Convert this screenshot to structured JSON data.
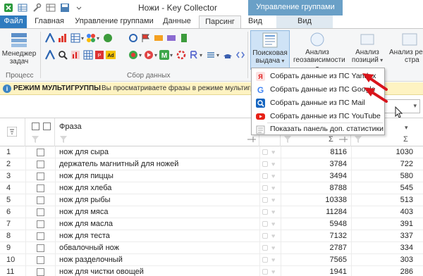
{
  "window": {
    "title": "Ножи - Key Collector",
    "context_group": "Управление группами"
  },
  "tabs": [
    {
      "label": "Файл"
    },
    {
      "label": "Главная"
    },
    {
      "label": "Управление группами"
    },
    {
      "label": "Данные"
    },
    {
      "label": "Парсинг"
    },
    {
      "label": "Вид"
    },
    {
      "label": "Вид"
    }
  ],
  "ribbon": {
    "manager_label": "Менеджер задач",
    "group_process": "Процесс",
    "group_collect": "Сбор данных",
    "search_results": "Поисковая выдача",
    "geo_analysis": "Анализ геозависимости",
    "position_analysis": "Анализ позиций",
    "analysis_cut": "Анализ ре",
    "analysis_cut_2": "стра"
  },
  "infobar": {
    "title": "РЕЖИМ МУЛЬТИГРУППЫ",
    "text": "Вы просматриваете фразы в режиме мультигрупп"
  },
  "menu": {
    "items": [
      {
        "label": "Собрать данные из ПС Yandex",
        "icon": "yandex-icon"
      },
      {
        "label": "Собрать данные из ПС Google",
        "icon": "google-icon"
      },
      {
        "label": "Собрать данные из ПС Mail",
        "icon": "mail-search-icon"
      },
      {
        "label": "Собрать данные из ПС YouTube",
        "icon": "youtube-icon"
      },
      {
        "label": "Показать панель доп. статистики",
        "icon": "stats-panel-icon"
      }
    ]
  },
  "grid": {
    "column_phrase": "Фраза",
    "rows": [
      {
        "n": "1",
        "phrase": "нож для сыра",
        "v1": "8116",
        "v2": "1030"
      },
      {
        "n": "2",
        "phrase": "держатель магнитный для ножей",
        "v1": "3784",
        "v2": "722"
      },
      {
        "n": "3",
        "phrase": "нож для пиццы",
        "v1": "3494",
        "v2": "580"
      },
      {
        "n": "4",
        "phrase": "нож для хлеба",
        "v1": "8788",
        "v2": "545"
      },
      {
        "n": "5",
        "phrase": "нож для рыбы",
        "v1": "10338",
        "v2": "513"
      },
      {
        "n": "6",
        "phrase": "нож для мяса",
        "v1": "11284",
        "v2": "403"
      },
      {
        "n": "7",
        "phrase": "нож для масла",
        "v1": "5948",
        "v2": "391"
      },
      {
        "n": "8",
        "phrase": "нож для теста",
        "v1": "7132",
        "v2": "337"
      },
      {
        "n": "9",
        "phrase": "обвалочный нож",
        "v1": "2787",
        "v2": "334"
      },
      {
        "n": "10",
        "phrase": "нож разделочный",
        "v1": "7565",
        "v2": "303"
      },
      {
        "n": "11",
        "phrase": "нож для чистки овощей",
        "v1": "1941",
        "v2": "286"
      }
    ]
  },
  "colors": {
    "file_tab": "#2f7bbf",
    "context_band": "#6aa0c7",
    "infobar": "#fef3c2",
    "arrow": "#d8141b"
  }
}
